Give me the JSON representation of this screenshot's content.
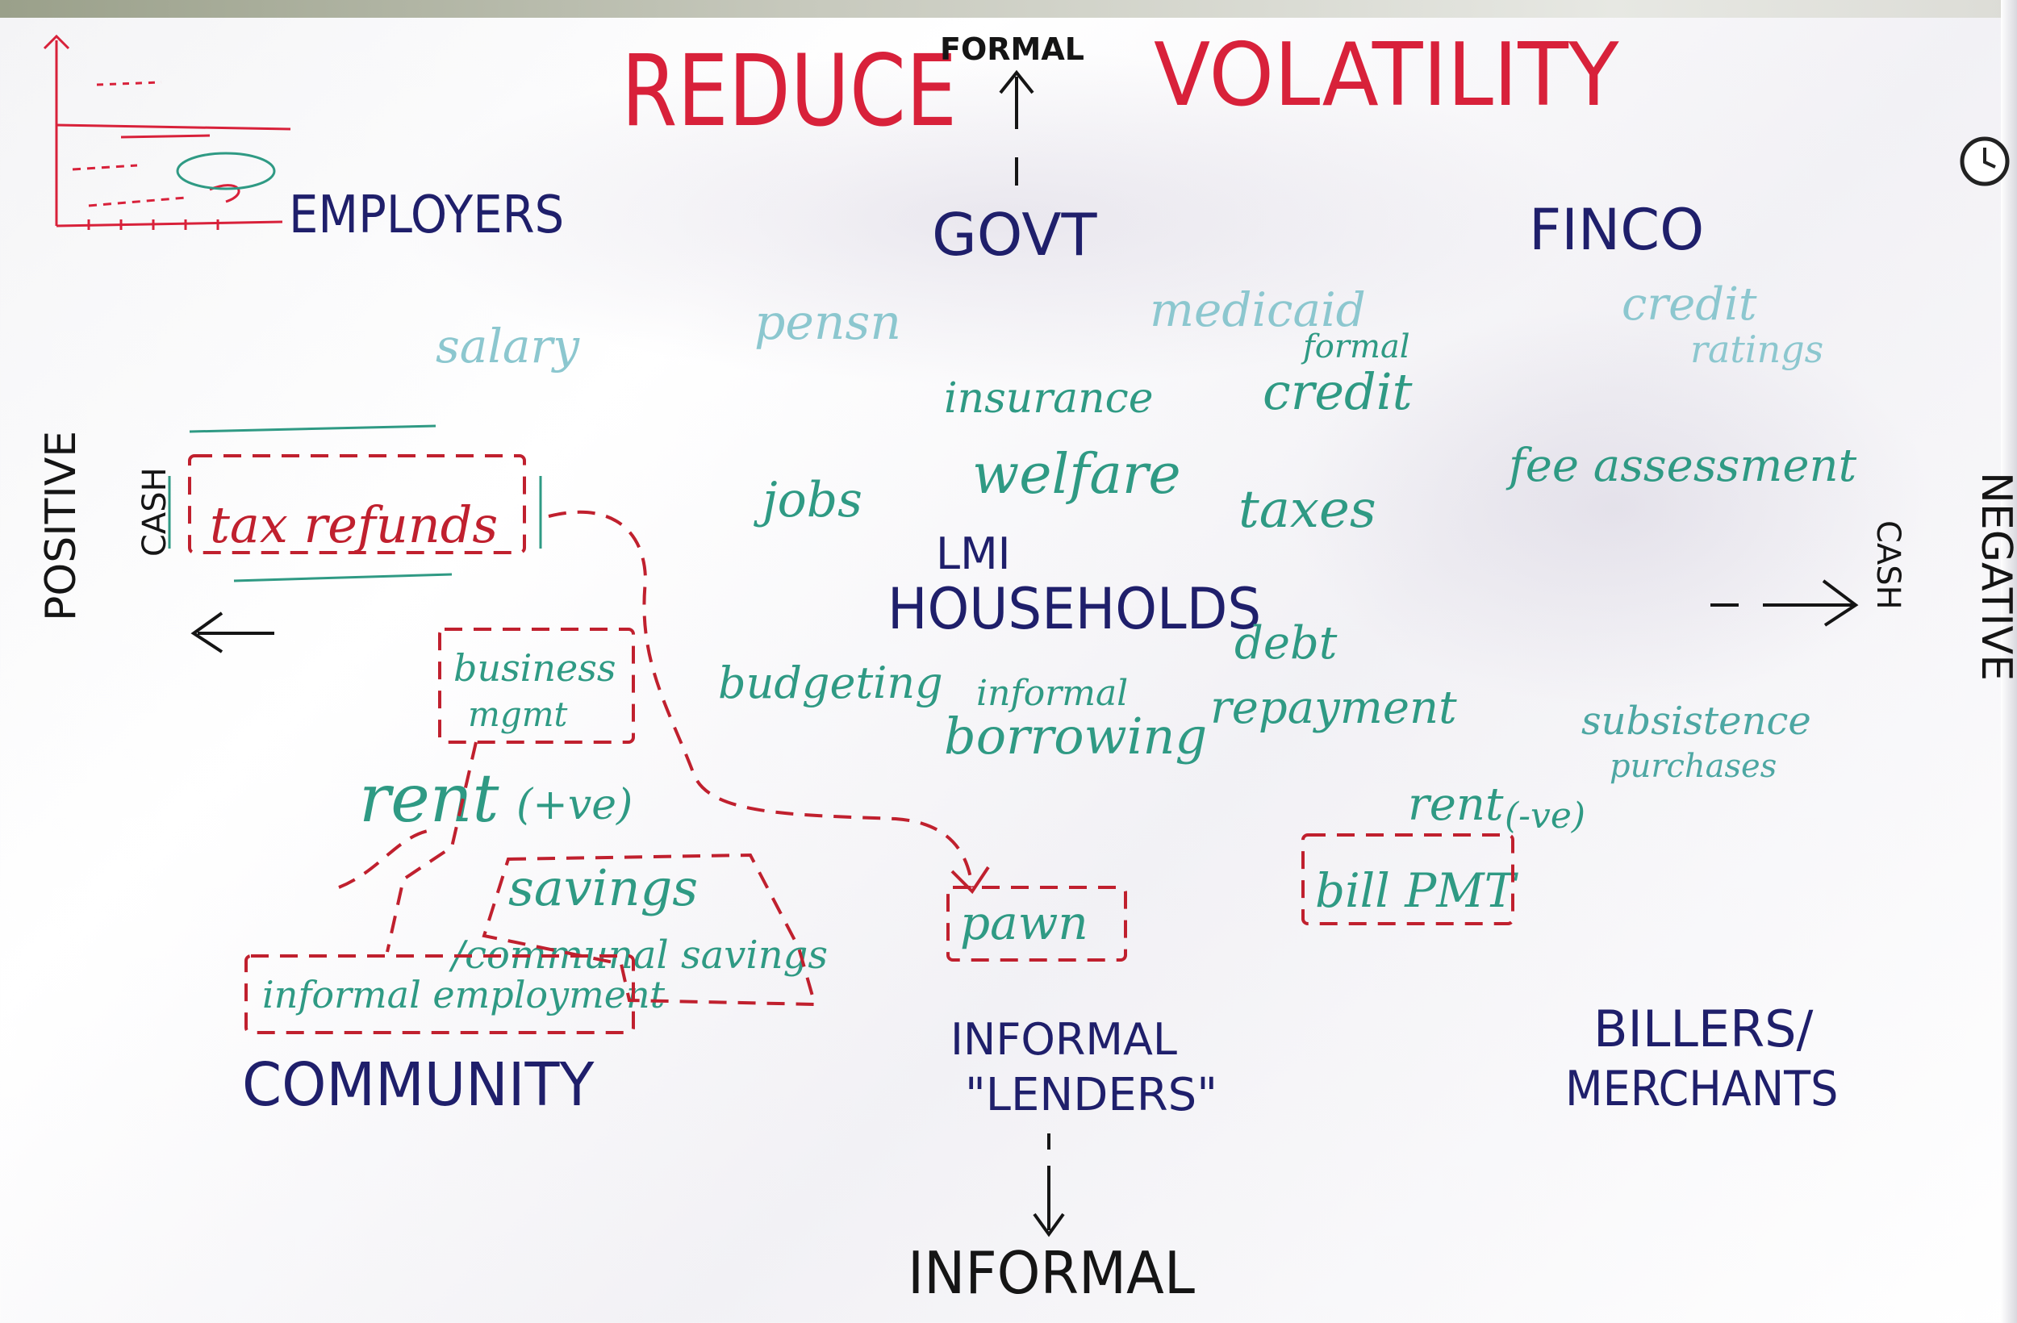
{
  "title": {
    "left": "REDUCE",
    "right": "VOLATILITY",
    "formal": "FORMAL"
  },
  "actors": {
    "employers": "EMPLOYERS",
    "govt": "GOVT",
    "finco": "FINCO",
    "lmi_line1": "LMI",
    "lmi_line2": "HOUSEHOLDS",
    "community": "COMMUNITY",
    "lenders_line1": "INFORMAL",
    "lenders_line2": "\"LENDERS\"",
    "billers_line1": "BILLERS/",
    "billers_line2": "MERCHANTS",
    "informal_bottom": "INFORMAL"
  },
  "axis": {
    "positive_line1": "POSITIVE",
    "positive_line2": "CASH",
    "negative_line1": "NEGATIVE",
    "negative_line2": "CASH"
  },
  "flows": {
    "salary": "salary",
    "pension": "pensn",
    "medicaid": "medicaid",
    "credit_ratings_line1": "credit",
    "credit_ratings_line2": "ratings",
    "insurance": "insurance",
    "formal_credit_line1": "formal",
    "formal_credit_line2": "credit",
    "tax_refunds": "tax refunds",
    "jobs": "jobs",
    "welfare": "welfare",
    "taxes": "taxes",
    "fee_assessment": "fee assessment",
    "business_mgmt_line1": "business",
    "business_mgmt_line2": "mgmt",
    "budgeting": "budgeting",
    "informal_borrowing_line1": "informal",
    "informal_borrowing_line2": "borrowing",
    "debt_repayment_line1": "debt",
    "debt_repayment_line2": "repayment",
    "subsistence_line1": "subsistence",
    "subsistence_line2": "purchases",
    "rent_positive": "rent",
    "rent_positive_note": "(+ve)",
    "rent_negative": "rent",
    "rent_negative_note": "(-ve)",
    "savings": "savings",
    "communal_savings": "/communal savings",
    "informal_employment": "informal employment",
    "pawn": "pawn",
    "bill_pmt": "bill PMT"
  },
  "colors": {
    "marker_navy": "#1f1f6b",
    "marker_red": "#d8213a",
    "marker_green": "#2f9a84",
    "marker_black": "#151515"
  },
  "icons": [
    "graph-sketch-icon",
    "clock-icon",
    "arrow-icon"
  ]
}
